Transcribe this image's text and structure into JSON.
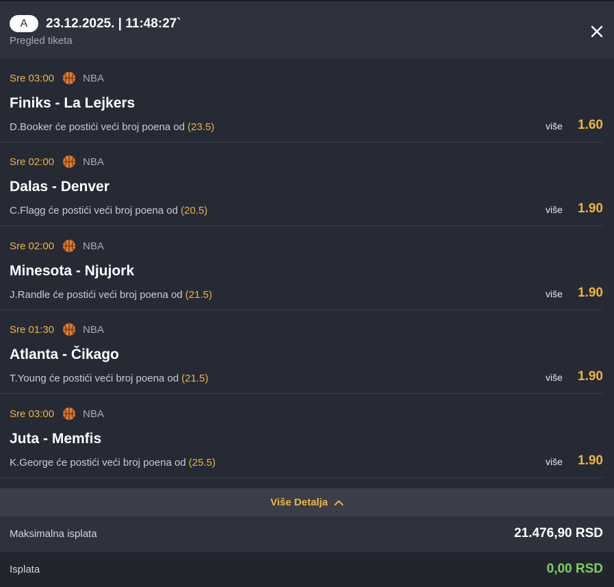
{
  "header": {
    "badge": "A",
    "datetime": "23.12.2025. | 11:48:27`",
    "subtitle": "Pregled tiketa",
    "close_icon": "close-icon"
  },
  "bets": [
    {
      "time": "Sre 03:00",
      "league": "NBA",
      "icon": "basketball-icon",
      "match": "Finiks - La Lejkers",
      "desc": "D.Booker će postići veći broj poena od",
      "line": "(23.5)",
      "pick": "više",
      "odd": "1.60"
    },
    {
      "time": "Sre 02:00",
      "league": "NBA",
      "icon": "basketball-icon",
      "match": "Dalas - Denver",
      "desc": "C.Flagg će postići veći broj poena od",
      "line": "(20.5)",
      "pick": "više",
      "odd": "1.90"
    },
    {
      "time": "Sre 02:00",
      "league": "NBA",
      "icon": "basketball-icon",
      "match": "Minesota - Njujork",
      "desc": "J.Randle će postići veći broj poena od",
      "line": "(21.5)",
      "pick": "više",
      "odd": "1.90"
    },
    {
      "time": "Sre 01:30",
      "league": "NBA",
      "icon": "basketball-icon",
      "match": "Atlanta - Čikago",
      "desc": "T.Young će postići veći broj poena od",
      "line": "(21.5)",
      "pick": "više",
      "odd": "1.90"
    },
    {
      "time": "Sre 03:00",
      "league": "NBA",
      "icon": "basketball-icon",
      "match": "Juta - Memfis",
      "desc": "K.George će postići veći broj poena od",
      "line": "(25.5)",
      "pick": "više",
      "odd": "1.90"
    }
  ],
  "details": {
    "label": "Više Detalja",
    "icon": "chevron-up-icon"
  },
  "summary": {
    "max_label": "Maksimalna isplata",
    "max_value": "21.476,90 RSD",
    "pay_label": "Isplata",
    "pay_value": "0,00 RSD"
  },
  "colors": {
    "accent": "#f0b43c",
    "payout_green": "#7fd05c",
    "background": "#262a35",
    "header_bg": "#2e323d"
  }
}
